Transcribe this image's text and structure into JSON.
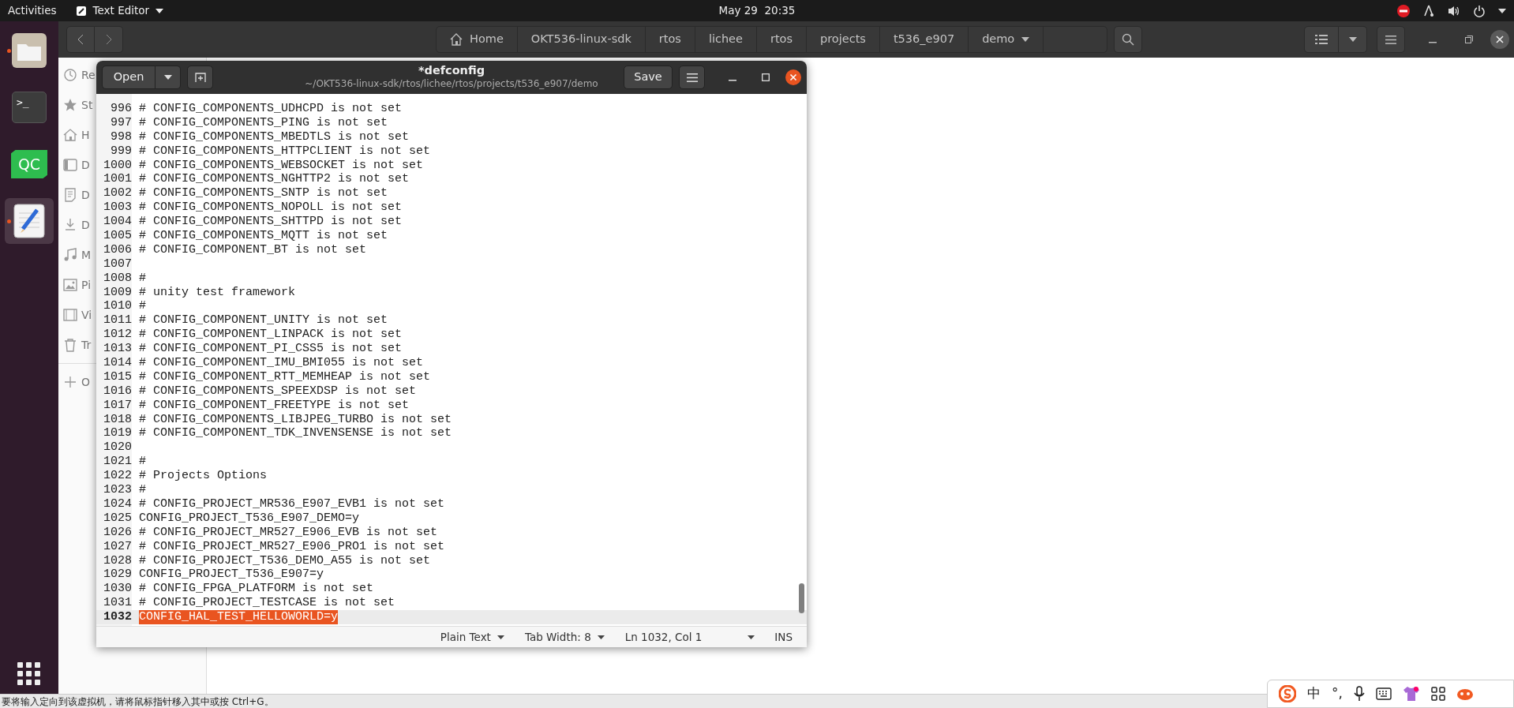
{
  "top_bar": {
    "activities": "Activities",
    "app_menu": "Text Editor",
    "clock": "May 29  20:35"
  },
  "dock": {
    "apps": [
      {
        "kind": "files",
        "running": true,
        "selected": false
      },
      {
        "kind": "terminal",
        "label": ">_",
        "running": false,
        "selected": false
      },
      {
        "kind": "qc",
        "label": "QC",
        "running": false,
        "selected": false
      },
      {
        "kind": "editor",
        "running": true,
        "selected": true
      }
    ]
  },
  "file_manager": {
    "path": [
      {
        "kind": "home",
        "label": "Home",
        "current": false
      },
      {
        "kind": "folder",
        "label": "OKT536-linux-sdk",
        "current": false
      },
      {
        "kind": "folder",
        "label": "rtos",
        "current": false
      },
      {
        "kind": "folder",
        "label": "lichee",
        "current": false
      },
      {
        "kind": "folder",
        "label": "rtos",
        "current": false
      },
      {
        "kind": "folder",
        "label": "projects",
        "current": false
      },
      {
        "kind": "folder",
        "label": "t536_e907",
        "current": false
      },
      {
        "kind": "folder",
        "label": "demo",
        "current": true
      }
    ],
    "sidebar": [
      {
        "kind": "recent",
        "label": "Re"
      },
      {
        "kind": "starred",
        "label": "St"
      },
      {
        "kind": "home",
        "label": "H"
      },
      {
        "kind": "desktop",
        "label": "D"
      },
      {
        "kind": "documents",
        "label": "D"
      },
      {
        "kind": "downloads",
        "label": "D"
      },
      {
        "kind": "music",
        "label": "M"
      },
      {
        "kind": "pictures",
        "label": "Pi"
      },
      {
        "kind": "videos",
        "label": "Vi"
      },
      {
        "kind": "trash",
        "label": "Tr"
      },
      {
        "kind": "other",
        "label": "O"
      }
    ]
  },
  "editor": {
    "title": "*defconfig",
    "subtitle": "~/OKT536-linux-sdk/rtos/lichee/rtos/projects/t536_e907/demo",
    "open_button": "Open",
    "save_button": "Save",
    "lines": [
      {
        "num": "996",
        "text": "# CONFIG_COMPONENTS_UDHCPD is not set",
        "current": false,
        "selected": false
      },
      {
        "num": "997",
        "text": "# CONFIG_COMPONENTS_PING is not set",
        "current": false,
        "selected": false
      },
      {
        "num": "998",
        "text": "# CONFIG_COMPONENTS_MBEDTLS is not set",
        "current": false,
        "selected": false
      },
      {
        "num": "999",
        "text": "# CONFIG_COMPONENTS_HTTPCLIENT is not set",
        "current": false,
        "selected": false
      },
      {
        "num": "1000",
        "text": "# CONFIG_COMPONENTS_WEBSOCKET is not set",
        "current": false,
        "selected": false
      },
      {
        "num": "1001",
        "text": "# CONFIG_COMPONENTS_NGHTTP2 is not set",
        "current": false,
        "selected": false
      },
      {
        "num": "1002",
        "text": "# CONFIG_COMPONENTS_SNTP is not set",
        "current": false,
        "selected": false
      },
      {
        "num": "1003",
        "text": "# CONFIG_COMPONENTS_NOPOLL is not set",
        "current": false,
        "selected": false
      },
      {
        "num": "1004",
        "text": "# CONFIG_COMPONENTS_SHTTPD is not set",
        "current": false,
        "selected": false
      },
      {
        "num": "1005",
        "text": "# CONFIG_COMPONENTS_MQTT is not set",
        "current": false,
        "selected": false
      },
      {
        "num": "1006",
        "text": "# CONFIG_COMPONENT_BT is not set",
        "current": false,
        "selected": false
      },
      {
        "num": "1007",
        "current": false
      },
      {
        "num": "1008",
        "text": "#",
        "current": false,
        "selected": false
      },
      {
        "num": "1009",
        "text": "# unity test framework",
        "current": false,
        "selected": false
      },
      {
        "num": "1010",
        "text": "#",
        "current": false,
        "selected": false
      },
      {
        "num": "1011",
        "text": "# CONFIG_COMPONENT_UNITY is not set",
        "current": false,
        "selected": false
      },
      {
        "num": "1012",
        "text": "# CONFIG_COMPONENT_LINPACK is not set",
        "current": false,
        "selected": false
      },
      {
        "num": "1013",
        "text": "# CONFIG_COMPONENT_PI_CSS5 is not set",
        "current": false,
        "selected": false
      },
      {
        "num": "1014",
        "text": "# CONFIG_COMPONENT_IMU_BMI055 is not set",
        "current": false,
        "selected": false
      },
      {
        "num": "1015",
        "text": "# CONFIG_COMPONENT_RTT_MEMHEAP is not set",
        "current": false,
        "selected": false
      },
      {
        "num": "1016",
        "text": "# CONFIG_COMPONENTS_SPEEXDSP is not set",
        "current": false,
        "selected": false
      },
      {
        "num": "1017",
        "text": "# CONFIG_COMPONENT_FREETYPE is not set",
        "current": false,
        "selected": false
      },
      {
        "num": "1018",
        "text": "# CONFIG_COMPONENTS_LIBJPEG_TURBO is not set",
        "current": false,
        "selected": false
      },
      {
        "num": "1019",
        "text": "# CONFIG_COMPONENT_TDK_INVENSENSE is not set",
        "current": false,
        "selected": false
      },
      {
        "num": "1020",
        "current": false
      },
      {
        "num": "1021",
        "text": "#",
        "current": false,
        "selected": false
      },
      {
        "num": "1022",
        "text": "# Projects Options",
        "current": false,
        "selected": false
      },
      {
        "num": "1023",
        "text": "#",
        "current": false,
        "selected": false
      },
      {
        "num": "1024",
        "text": "# CONFIG_PROJECT_MR536_E907_EVB1 is not set",
        "current": false,
        "selected": false
      },
      {
        "num": "1025",
        "text": "CONFIG_PROJECT_T536_E907_DEMO=y",
        "current": false,
        "selected": false
      },
      {
        "num": "1026",
        "text": "# CONFIG_PROJECT_MR527_E906_EVB is not set",
        "current": false,
        "selected": false
      },
      {
        "num": "1027",
        "text": "# CONFIG_PROJECT_MR527_E906_PRO1 is not set",
        "current": false,
        "selected": false
      },
      {
        "num": "1028",
        "text": "# CONFIG_PROJECT_T536_DEMO_A55 is not set",
        "current": false,
        "selected": false
      },
      {
        "num": "1029",
        "text": "CONFIG_PROJECT_T536_E907=y",
        "current": false,
        "selected": false
      },
      {
        "num": "1030",
        "text": "# CONFIG_FPGA_PLATFORM is not set",
        "current": false,
        "selected": false
      },
      {
        "num": "1031",
        "text": "# CONFIG_PROJECT_TESTCASE is not set",
        "current": false,
        "selected": false
      },
      {
        "num": "1032",
        "text": "CONFIG_HAL_TEST_HELLOWORLD=y",
        "current": true,
        "selected": true
      }
    ],
    "status": {
      "language": "Plain Text",
      "tab_width": "Tab Width: 8",
      "position": "Ln 1032, Col 1",
      "mode": "INS"
    }
  },
  "vm_hint": "要将输入定向到该虚拟机，请将鼠标指针移入其中或按 Ctrl+G。",
  "ime_toolbar": {
    "language": "中",
    "punctuation": "°,"
  }
}
